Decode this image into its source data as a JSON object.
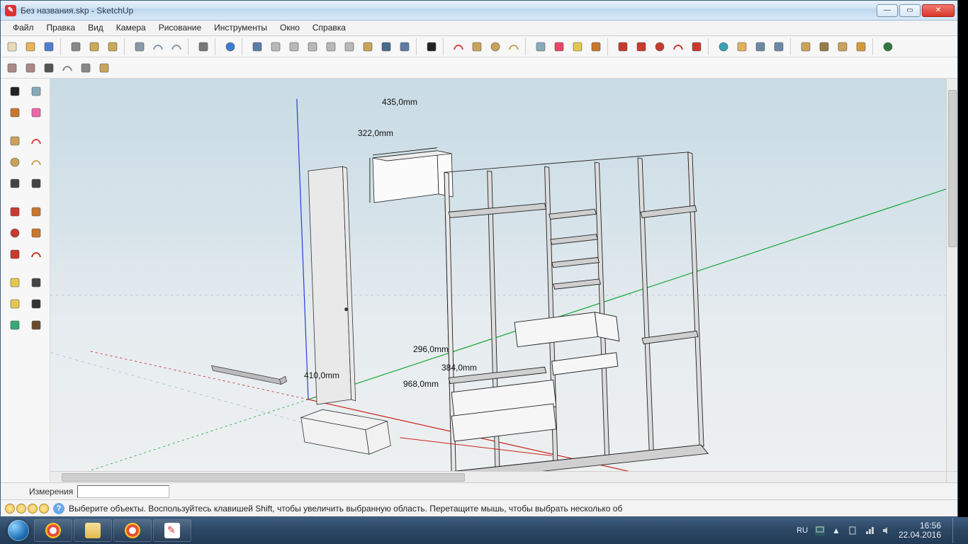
{
  "window": {
    "title": "Без названия.skp - SketchUp",
    "min": "—",
    "max": "▭",
    "close": "✕"
  },
  "menu": [
    "Файл",
    "Правка",
    "Вид",
    "Камера",
    "Рисование",
    "Инструменты",
    "Окно",
    "Справка"
  ],
  "toolbar_top": [
    {
      "n": "new-file",
      "c": "#e9d9b8"
    },
    {
      "n": "open-file",
      "c": "#e9b35a"
    },
    {
      "n": "save-file",
      "c": "#4e7ecd"
    },
    {
      "n": "sep"
    },
    {
      "n": "cut",
      "c": "#888"
    },
    {
      "n": "copy",
      "c": "#c9a95a"
    },
    {
      "n": "paste",
      "c": "#c9a95a"
    },
    {
      "n": "sep"
    },
    {
      "n": "erase",
      "c": "#8899aa"
    },
    {
      "n": "undo",
      "c": "#8899aa"
    },
    {
      "n": "redo",
      "c": "#8899aa"
    },
    {
      "n": "sep"
    },
    {
      "n": "print",
      "c": "#777"
    },
    {
      "n": "sep"
    },
    {
      "n": "model-info",
      "c": "#3a7bd5"
    },
    {
      "n": "sep"
    },
    {
      "n": "iso-view",
      "c": "#5e7aa8"
    },
    {
      "n": "top-view",
      "c": "#b8b8b8"
    },
    {
      "n": "front-view",
      "c": "#b8b8b8"
    },
    {
      "n": "right-view",
      "c": "#b8b8b8"
    },
    {
      "n": "back-view",
      "c": "#b8b8b8"
    },
    {
      "n": "left-view",
      "c": "#b8b8b8"
    },
    {
      "n": "bottom-view",
      "c": "#c9a55a"
    },
    {
      "n": "wireframe-view",
      "c": "#4a6a8a"
    },
    {
      "n": "shaded-view",
      "c": "#5e7aa8"
    },
    {
      "n": "sep"
    },
    {
      "n": "select-tool",
      "c": "#222"
    },
    {
      "n": "sep"
    },
    {
      "n": "line-tool",
      "c": "#d44"
    },
    {
      "n": "rectangle-tool",
      "c": "#caa25a"
    },
    {
      "n": "circle-tool",
      "c": "#caa25a"
    },
    {
      "n": "arc-tool",
      "c": "#caa25a"
    },
    {
      "n": "sep"
    },
    {
      "n": "make-component",
      "c": "#8ab"
    },
    {
      "n": "eraser-tool",
      "c": "#e46"
    },
    {
      "n": "tape-measure",
      "c": "#e2c94e"
    },
    {
      "n": "paint-bucket",
      "c": "#c9762e"
    },
    {
      "n": "sep"
    },
    {
      "n": "push-pull",
      "c": "#c9392e"
    },
    {
      "n": "move-tool",
      "c": "#c9392e"
    },
    {
      "n": "rotate-tool",
      "c": "#c9392e"
    },
    {
      "n": "offset-tool",
      "c": "#c9392e"
    },
    {
      "n": "scale-tool",
      "c": "#c9392e"
    },
    {
      "n": "sep"
    },
    {
      "n": "orbit-tool",
      "c": "#3aa0b8"
    },
    {
      "n": "pan-tool",
      "c": "#e0b060"
    },
    {
      "n": "zoom-tool",
      "c": "#6a8aa8"
    },
    {
      "n": "zoom-window",
      "c": "#6a8aa8"
    },
    {
      "n": "sep"
    },
    {
      "n": "position-camera",
      "c": "#caa25a"
    },
    {
      "n": "walk-tool",
      "c": "#9a7a4a"
    },
    {
      "n": "look-around",
      "c": "#caa25a"
    },
    {
      "n": "section-plane",
      "c": "#d49a3a"
    },
    {
      "n": "sep"
    },
    {
      "n": "google-earth",
      "c": "#2e7a3a"
    }
  ],
  "toolbar_second": [
    {
      "n": "xray-style",
      "c": "#a88"
    },
    {
      "n": "back-edges-style",
      "c": "#a88"
    },
    {
      "n": "wire-style",
      "c": "#555"
    },
    {
      "n": "hidden-line-style",
      "c": "#888"
    },
    {
      "n": "shaded-style",
      "c": "#888"
    },
    {
      "n": "shaded-tex-style",
      "c": "#c9a55a"
    }
  ],
  "left_panel": [
    [
      {
        "n": "select-tool",
        "c": "#222"
      },
      {
        "n": "make-component",
        "c": "#8ab"
      }
    ],
    [
      {
        "n": "paint-bucket",
        "c": "#c9762e"
      },
      {
        "n": "eraser-tool",
        "c": "#e6a"
      }
    ],
    [],
    [
      {
        "n": "rectangle-tool",
        "c": "#caa25a"
      },
      {
        "n": "line-tool",
        "c": "#d44"
      }
    ],
    [
      {
        "n": "circle-tool",
        "c": "#caa25a"
      },
      {
        "n": "arc-tool",
        "c": "#caa25a"
      }
    ],
    [
      {
        "n": "polygon-tool",
        "c": "#444"
      },
      {
        "n": "freehand-tool",
        "c": "#444"
      }
    ],
    [],
    [
      {
        "n": "move-tool",
        "c": "#c9392e"
      },
      {
        "n": "push-pull",
        "c": "#c9762e"
      }
    ],
    [
      {
        "n": "rotate-tool",
        "c": "#c9392e"
      },
      {
        "n": "follow-me",
        "c": "#c9762e"
      }
    ],
    [
      {
        "n": "scale-tool",
        "c": "#c9392e"
      },
      {
        "n": "offset-tool",
        "c": "#c9392e"
      }
    ],
    [],
    [
      {
        "n": "tape-measure",
        "c": "#e2c94e"
      },
      {
        "n": "dimension-tool",
        "c": "#444"
      }
    ],
    [
      {
        "n": "protractor",
        "c": "#e2c94e"
      },
      {
        "n": "text-tool",
        "c": "#333"
      }
    ],
    [
      {
        "n": "axes-tool",
        "c": "#3a7"
      },
      {
        "n": "3d-text",
        "c": "#6a4a2a"
      }
    ]
  ],
  "dimensions": {
    "d1": "435,0mm",
    "d2": "322,0mm",
    "d3": "296,0mm",
    "d4": "384,0mm",
    "d5": "968,0mm",
    "d6": "410,0mm"
  },
  "measure_label": "Измерения",
  "measure_value": "",
  "status_hint": "Выберите объекты. Воспользуйтесь клавишей Shift, чтобы увеличить выбранную область. Перетащите мышь, чтобы выбрать несколько об",
  "question_mark": "?",
  "taskbar": {
    "lang": "RU",
    "time": "16:56",
    "date": "22.04.2016"
  }
}
